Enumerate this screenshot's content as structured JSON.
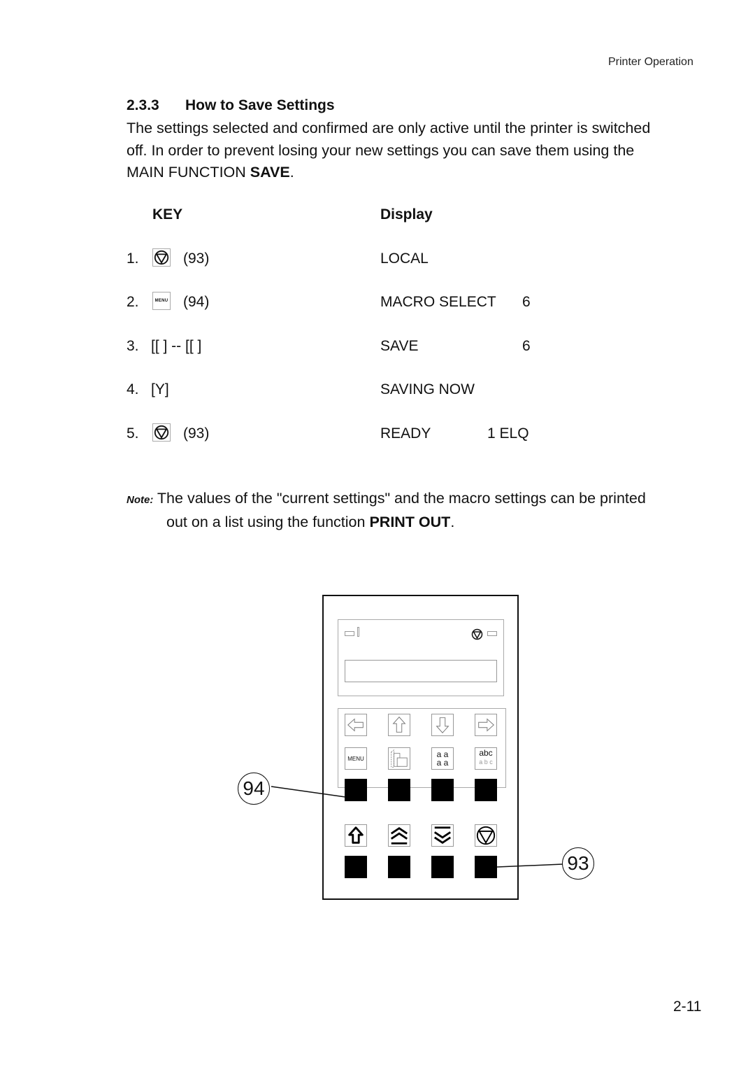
{
  "header": {
    "running_title": "Printer Operation"
  },
  "section": {
    "number": "2.3.3",
    "title": "How to Save Settings",
    "intro_lines": [
      "The settings selected and confirmed are only active until the printer is switched",
      "off. In order to prevent losing your new settings you can save them using the"
    ],
    "intro_last_prefix": "MAIN FUNCTION ",
    "intro_last_bold": "SAVE",
    "intro_last_suffix": "."
  },
  "table": {
    "key_header": "KEY",
    "display_header": "Display",
    "rows": [
      {
        "step": "1.",
        "key_icon": "online-triangle-icon",
        "key_text": "(93)",
        "display": "LOCAL",
        "display_value": ""
      },
      {
        "step": "2.",
        "key_icon": "menu-key-icon",
        "key_text": "(94)",
        "display": "MACRO SELECT",
        "display_value": "6"
      },
      {
        "step": "3.",
        "key_icon": "",
        "key_text": "[[ ] -- [[ ]",
        "display": "SAVE",
        "display_value": "6"
      },
      {
        "step": "4.",
        "key_icon": "",
        "key_text": "[Y]",
        "display": "SAVING NOW",
        "display_value": ""
      },
      {
        "step": "5.",
        "key_icon": "online-triangle-icon",
        "key_text": "(93)",
        "display": "READY",
        "display_value": "1 ELQ"
      }
    ],
    "menu_icon_label": "MENU"
  },
  "note": {
    "label": "Note:",
    "line1": "The values of the \"current settings\" and the macro settings can be printed",
    "line2_prefix": "out on a list using the function ",
    "line2_bold": "PRINT OUT",
    "line2_suffix": "."
  },
  "panel": {
    "row1_icons": [
      "left-arrow-icon",
      "up-arrow-icon",
      "down-arrow-icon",
      "right-arrow-icon"
    ],
    "row2_icons": [
      "menu-key-icon",
      "paper-feed-icon",
      "font-icon",
      "pitch-icon"
    ],
    "row3_icons": [
      "shift-icon",
      "feed-up-icon",
      "feed-down-icon",
      "online-triangle-icon"
    ],
    "menu_label": "MENU",
    "font_label_top": "a a",
    "font_label_bottom": "a a",
    "pitch_label_top": "abc",
    "pitch_label_bottom": "a b c",
    "callouts": {
      "menu_key": "94",
      "online_key": "93"
    }
  },
  "footer": {
    "page_number": "2-11"
  }
}
